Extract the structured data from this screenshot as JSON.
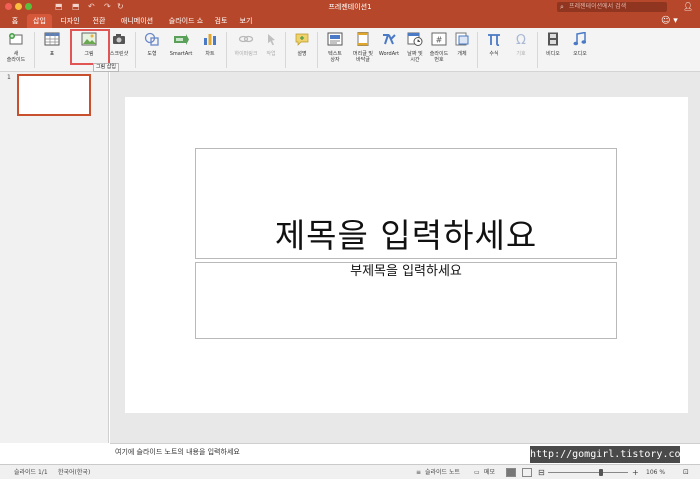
{
  "window": {
    "title": "프레젠테이션1"
  },
  "quick_access": {
    "save_icon": "⬒",
    "undo_icon": "↶",
    "redo_icon": "↷",
    "refresh_icon": "↻"
  },
  "search": {
    "placeholder": "프레젠테이션에서 검색"
  },
  "tabs": [
    {
      "label": "홈",
      "active": false
    },
    {
      "label": "삽입",
      "active": true
    },
    {
      "label": "디자인",
      "active": false
    },
    {
      "label": "전환",
      "active": false
    },
    {
      "label": "애니메이션",
      "active": false
    },
    {
      "label": "슬라이드 쇼",
      "active": false
    },
    {
      "label": "검토",
      "active": false
    },
    {
      "label": "보기",
      "active": false
    }
  ],
  "ribbon": {
    "new_slide": "새\n슬라이드",
    "table": "표",
    "picture": "그림",
    "screenshot": "스크린샷",
    "shapes": "도형",
    "smartart": "SmartArt",
    "chart": "차트",
    "hyperlink": "하이퍼링크",
    "action": "작업",
    "comment": "설명",
    "textbox": "텍스트\n상자",
    "header_footer": "머리글 및\n바닥글",
    "wordart": "WordArt",
    "date_time": "날짜 및\n시간",
    "slide_number": "슬라이드\n번호",
    "object": "개체",
    "equation": "수식",
    "symbol": "기호",
    "video": "비디오",
    "audio": "오디오"
  },
  "tooltip": {
    "text": "그림 삽입"
  },
  "thumbnail": {
    "number": "1"
  },
  "slide": {
    "title_placeholder": "제목을 입력하세요",
    "subtitle_placeholder": "부제목을 입력하세요"
  },
  "notes": {
    "placeholder": "여기에 슬라이드 노트의 내용을 입력하세요"
  },
  "watermark": {
    "text": "http://gomgirl.tistory.com"
  },
  "status": {
    "slide_info": "슬라이드 1/1",
    "language": "한국어(한국)",
    "notes_btn": "슬라이드 노트",
    "comments_btn": "메모",
    "zoom": "106 %",
    "zoom_fraction": 0.55
  },
  "colors": {
    "accent": "#b7472a",
    "highlight": "#e25555"
  }
}
